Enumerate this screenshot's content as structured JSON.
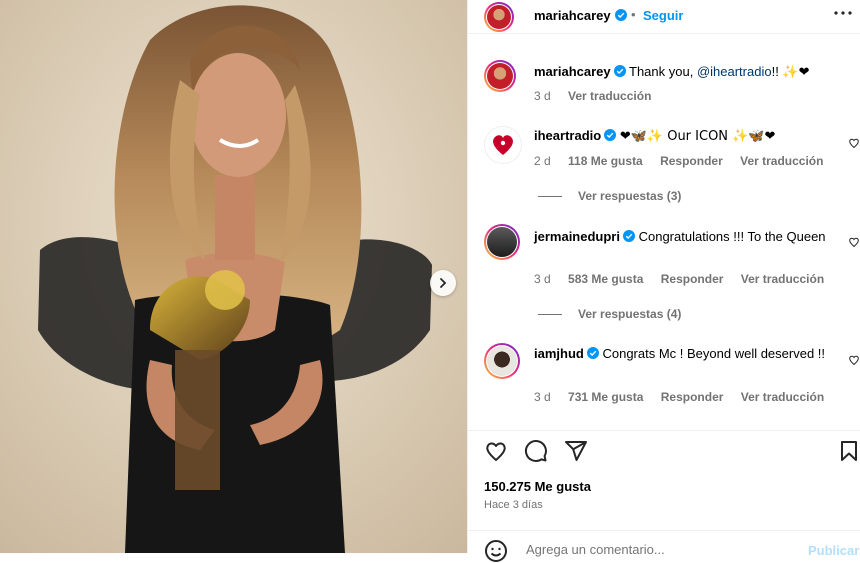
{
  "header": {
    "username": "mariahcarey",
    "dot": "•",
    "follow_label": "Seguir",
    "more_icon": "more-horizontal-icon"
  },
  "caption": {
    "username": "mariahcarey",
    "text_before": "Thank you, ",
    "mention": "@iheartradio",
    "text_after": "!! ",
    "emojis": "✨❤",
    "time": "3 d",
    "translate": "Ver traducción"
  },
  "comments": [
    {
      "username": "iheartradio",
      "text": "❤🦋✨ Our ICON ✨🦋❤",
      "time": "2 d",
      "likes": "118 Me gusta",
      "reply": "Responder",
      "translate": "Ver traducción",
      "replies": "Ver respuestas (3)"
    },
    {
      "username": "jermainedupri",
      "text": "Congratulations !!! To the Queen",
      "time": "3 d",
      "likes": "583 Me gusta",
      "reply": "Responder",
      "translate": "Ver traducción",
      "replies": "Ver respuestas (4)"
    },
    {
      "username": "iamjhud",
      "text": "Congrats Mc ! Beyond well deserved !!",
      "time": "3 d",
      "likes": "731 Me gusta",
      "reply": "Responder",
      "translate": "Ver traducción"
    }
  ],
  "actions": {
    "like_icon": "heart-icon",
    "comment_icon": "comment-icon",
    "share_icon": "send-icon",
    "save_icon": "bookmark-icon"
  },
  "stats": {
    "likes": "150.275 Me gusta",
    "ago": "Hace 3 días"
  },
  "add_comment": {
    "placeholder": "Agrega un comentario...",
    "post_label": "Publicar",
    "emoji_icon": "smiley-icon"
  },
  "colors": {
    "accent": "#0095f6",
    "verified": "#0095f6",
    "secondary_text": "#737373",
    "heart": "#ed4956"
  }
}
